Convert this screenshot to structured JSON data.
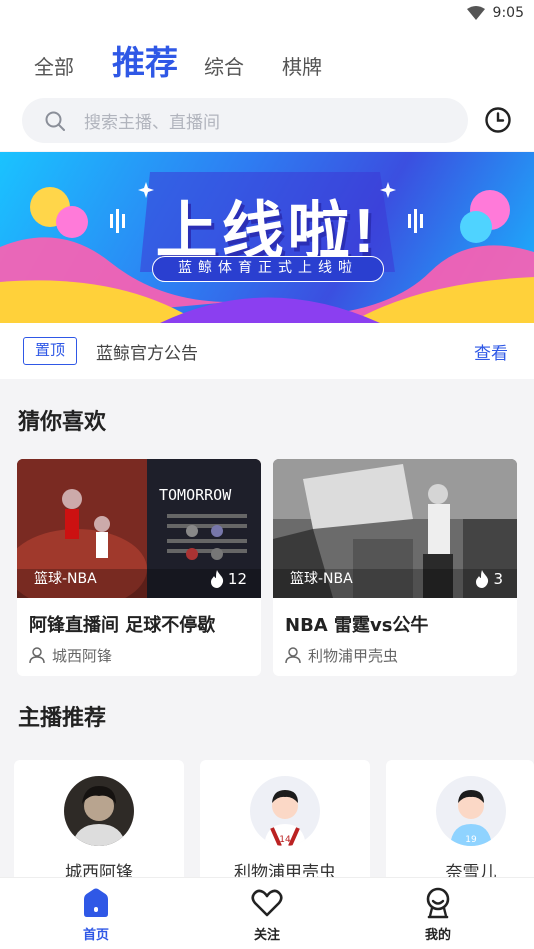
{
  "status": {
    "time": "9:05"
  },
  "header": {
    "tabs": [
      {
        "label": "全部",
        "active": false
      },
      {
        "label": "推荐",
        "active": true
      },
      {
        "label": "综合",
        "active": false
      },
      {
        "label": "棋牌",
        "active": false
      }
    ],
    "search_placeholder": "搜索主播、直播间"
  },
  "banner": {
    "title": "上线啦!",
    "subtitle": "蓝鲸体育正式上线啦"
  },
  "notice": {
    "tag": "置顶",
    "text": "蓝鲸官方公告",
    "link": "查看"
  },
  "sections": {
    "guess": "猜你喜欢",
    "anchors": "主播推荐"
  },
  "cards": [
    {
      "category": "篮球-NBA",
      "heat": "12",
      "title": "阿锋直播间 足球不停歇",
      "author": "城西阿锋",
      "thumb_caption": "TOMORROW"
    },
    {
      "category": "篮球-NBA",
      "heat": "3",
      "title": "NBA 雷霆vs公牛",
      "author": "利物浦甲壳虫"
    }
  ],
  "anchors": [
    {
      "name": "城西阿锋"
    },
    {
      "name": "利物浦甲壳虫",
      "jersey": "14"
    },
    {
      "name": "奈雪儿",
      "jersey": "19"
    }
  ],
  "nav": [
    {
      "label": "首页",
      "icon": "home-icon",
      "active": true
    },
    {
      "label": "关注",
      "icon": "heart-icon",
      "active": false
    },
    {
      "label": "我的",
      "icon": "user-icon",
      "active": false
    }
  ],
  "colors": {
    "accent": "#2f58e6",
    "bg": "#f4f4f6"
  }
}
